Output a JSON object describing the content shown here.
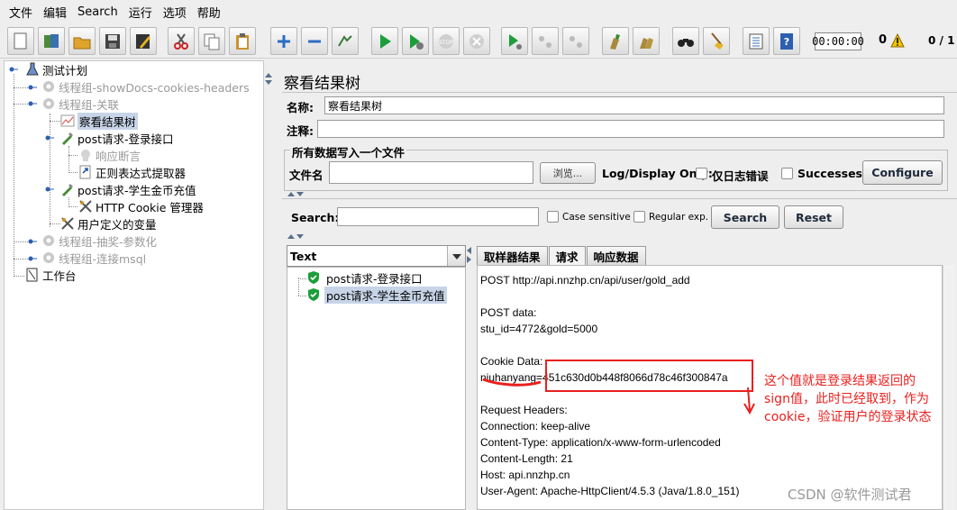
{
  "menu": [
    "文件",
    "编辑",
    "Search",
    "运行",
    "选项",
    "帮助"
  ],
  "toolbar": {
    "icons": [
      "new-icon",
      "templates-icon",
      "open-icon",
      "save-icon",
      "save-as-icon",
      "cut-icon",
      "copy-icon",
      "paste-icon",
      "expand-icon",
      "collapse-icon",
      "toggle-icon",
      "start-icon",
      "start-no-pause-icon",
      "stop-icon",
      "shutdown-icon",
      "remote-start-icon",
      "remote-stop-icon",
      "remote-exit-icon",
      "clear-icon",
      "clear-all-icon",
      "search-icon",
      "reset-search-icon",
      "function-helper-icon",
      "help-icon"
    ],
    "timer": "00:00:00",
    "warnings": "0",
    "threads": "0 / 1"
  },
  "tree": [
    {
      "label": "测试计划",
      "disabled": false,
      "icon": "test-plan-icon"
    },
    {
      "label": "线程组-showDocs-cookies-headers",
      "disabled": true,
      "icon": "thread-group-icon"
    },
    {
      "label": "线程组-关联",
      "disabled": true,
      "icon": "thread-group-icon"
    },
    {
      "label": "察看结果树",
      "disabled": false,
      "icon": "result-tree-icon",
      "selected": true
    },
    {
      "label": "post请求-登录接口",
      "disabled": false,
      "icon": "sampler-icon"
    },
    {
      "label": "响应断言",
      "disabled": true,
      "icon": "assertion-icon"
    },
    {
      "label": "正则表达式提取器",
      "disabled": false,
      "icon": "extractor-icon"
    },
    {
      "label": "post请求-学生金币充值",
      "disabled": false,
      "icon": "sampler-icon"
    },
    {
      "label": "HTTP Cookie 管理器",
      "disabled": false,
      "icon": "config-icon"
    },
    {
      "label": "用户定义的变量",
      "disabled": false,
      "icon": "config-icon"
    },
    {
      "label": "线程组-抽奖-参数化",
      "disabled": true,
      "icon": "thread-group-icon"
    },
    {
      "label": "线程组-连接msql",
      "disabled": true,
      "icon": "thread-group-icon"
    },
    {
      "label": "工作台",
      "disabled": false,
      "icon": "workbench-icon"
    }
  ],
  "panel": {
    "title": "察看结果树",
    "name_label": "名称:",
    "name_value": "察看结果树",
    "comment_label": "注释:",
    "comment_value": "",
    "file_group_title": "所有数据写入一个文件",
    "filename_label": "文件名",
    "filename_value": "",
    "browse_label": "浏览...",
    "log_display_label": "Log/Display Only:",
    "errors_only_label": "仅日志错误",
    "successes_label": "Successes",
    "configure_label": "Configure",
    "search_label": "Search:",
    "search_value": "",
    "case_sensitive_label": "Case sensitive",
    "regex_label": "Regular exp.",
    "search_button": "Search",
    "reset_button": "Reset"
  },
  "results": {
    "renderer": "Text",
    "items": [
      {
        "label": "post请求-登录接口",
        "status": "success"
      },
      {
        "label": "post请求-学生金币充值",
        "status": "success",
        "selected": true
      }
    ]
  },
  "tabs": [
    {
      "label": "取样器结果",
      "active": false
    },
    {
      "label": "请求",
      "active": true
    },
    {
      "label": "响应数据",
      "active": false
    }
  ],
  "request_lines": [
    "POST http://api.nnzhp.cn/api/user/gold_add",
    "",
    "POST data:",
    "stu_id=4772&gold=5000",
    "",
    "Cookie Data:",
    "niuhanyang=451c630d0b448f8066d78c46f300847a",
    "",
    "Request Headers:",
    "Connection: keep-alive",
    "Content-Type: application/x-www-form-urlencoded",
    "Content-Length: 21",
    "Host: api.nnzhp.cn",
    "User-Agent: Apache-HttpClient/4.5.3 (Java/1.8.0_151)"
  ],
  "annotation": [
    "这个值就是登录结果返回的",
    "sign值，此时已经取到，作为",
    "cookie，验证用户的登录状态"
  ],
  "watermark": "CSDN @软件测试君",
  "colors": {
    "accent": "#1f6fc5",
    "annotation": "#e8201e",
    "selection": "#c7d4e8",
    "success": "#1c9e3a"
  }
}
